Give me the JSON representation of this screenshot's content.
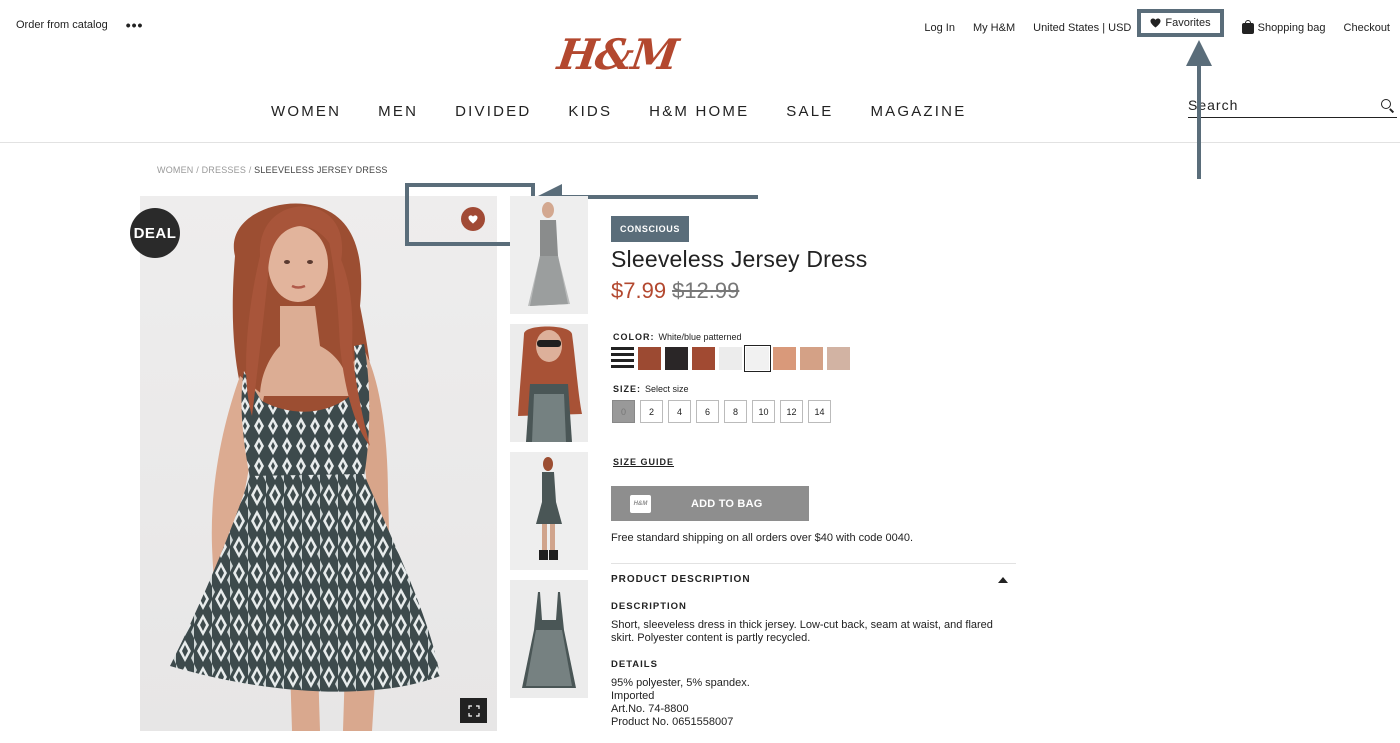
{
  "topbar": {
    "order_catalog": "Order from catalog",
    "more": "•••",
    "login": "Log In",
    "my_hm": "My H&M",
    "region": "United States | USD",
    "favorites": "Favorites",
    "shopping_bag": "Shopping bag",
    "checkout": "Checkout"
  },
  "logo": "H&M",
  "nav": [
    "WOMEN",
    "MEN",
    "DIVIDED",
    "KIDS",
    "H&M HOME",
    "SALE",
    "MAGAZINE"
  ],
  "search": {
    "placeholder": "Search"
  },
  "breadcrumb": {
    "level1": "WOMEN",
    "level2": "DRESSES",
    "current": "SLEEVELESS JERSEY DRESS",
    "sep": " / "
  },
  "deal_label": "DEAL",
  "product": {
    "badge": "CONSCIOUS",
    "title": "Sleeveless Jersey Dress",
    "price": "$7.99",
    "old_price": "$12.99",
    "color_label": "COLOR:",
    "color_value": "White/blue patterned",
    "swatches": [
      "#3a3a3a",
      "#9c4a32",
      "#2a2627",
      "#a14a32",
      "#ececec",
      "#f1f1f1",
      "#d9997a",
      "#d4a186",
      "#d2b3a3"
    ],
    "size_label": "SIZE:",
    "size_value": "Select size",
    "sizes": [
      "0",
      "2",
      "4",
      "6",
      "8",
      "10",
      "12",
      "14"
    ],
    "size_guide": "SIZE GUIDE",
    "add_to_bag": "ADD TO BAG",
    "bag_icon_text": "H&M",
    "shipping": "Free standard shipping on all orders over $40 with code 0040.",
    "desc_header": "PRODUCT DESCRIPTION",
    "desc_title": "DESCRIPTION",
    "desc_line1": "Short, sleeveless dress in thick jersey. Low-cut back, seam at waist, and flared",
    "desc_line2": "skirt. Polyester content is partly recycled.",
    "details_title": "DETAILS",
    "details": [
      "95% polyester, 5% spandex.",
      "Imported",
      "Art.No. 74-8800",
      "Product No. 0651558007"
    ]
  }
}
